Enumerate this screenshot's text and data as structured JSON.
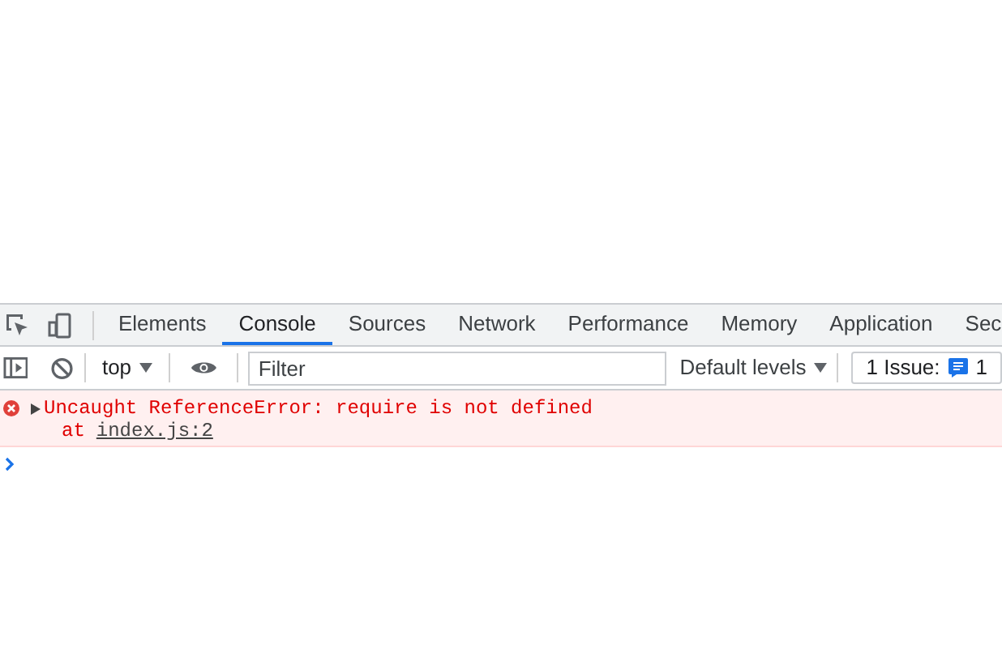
{
  "tabs": [
    {
      "label": "Elements",
      "selected": false
    },
    {
      "label": "Console",
      "selected": true
    },
    {
      "label": "Sources",
      "selected": false
    },
    {
      "label": "Network",
      "selected": false
    },
    {
      "label": "Performance",
      "selected": false
    },
    {
      "label": "Memory",
      "selected": false
    },
    {
      "label": "Application",
      "selected": false
    },
    {
      "label": "Sec",
      "selected": false
    }
  ],
  "toolbar": {
    "context": "top",
    "filter": {
      "placeholder": "Filter"
    },
    "levels": "Default levels",
    "issues": {
      "label": "1 Issue:",
      "count": "1"
    }
  },
  "messages": [
    {
      "kind": "error",
      "expanded": false,
      "text": "Uncaught ReferenceError: require is not defined",
      "location_prefix": "at",
      "location": "index.js:2"
    }
  ]
}
